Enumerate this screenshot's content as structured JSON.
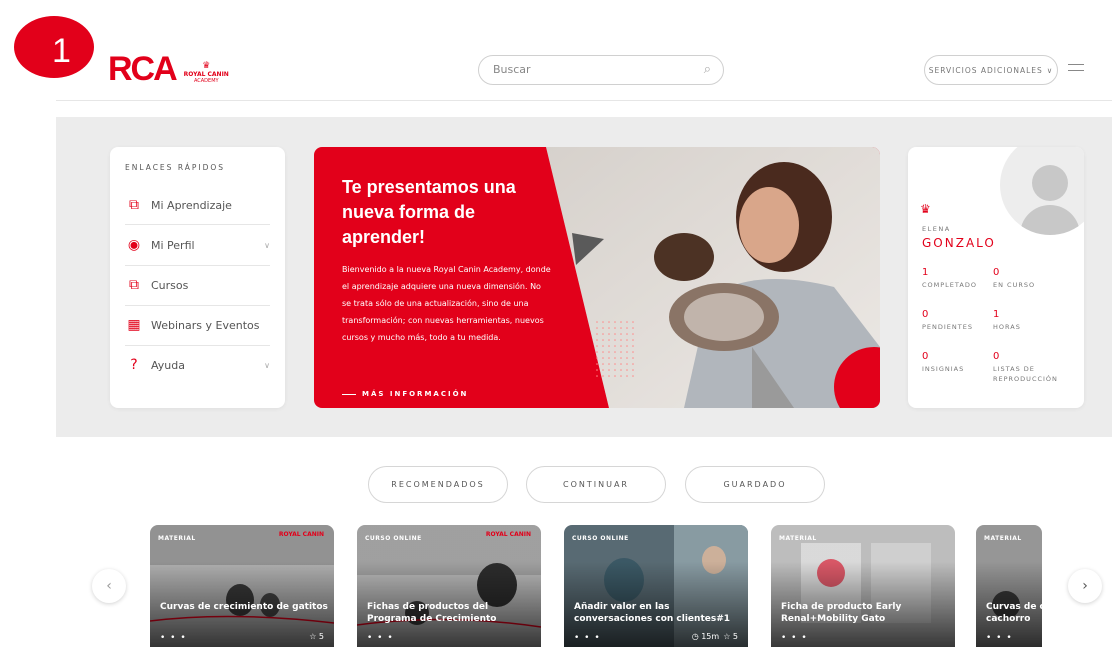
{
  "annotation": {
    "step_number": "1"
  },
  "header": {
    "logo_text": "RCA",
    "logo_brand": "ROYAL CANIN",
    "logo_sub": "ACADEMY",
    "search_placeholder": "Buscar",
    "services_label": "SERVICIOS ADICIONALES",
    "services_chevron": "∨",
    "menu_icon": "hamburger-icon"
  },
  "quick_links": {
    "title": "ENLACES RÁPIDOS",
    "items": [
      {
        "label": "Mi Aprendizaje",
        "icon": "book-icon",
        "glyph": "⧉",
        "has_chevron": false
      },
      {
        "label": "Mi Perfil",
        "icon": "user-circle-icon",
        "glyph": "◉",
        "has_chevron": true
      },
      {
        "label": "Cursos",
        "icon": "open-book-icon",
        "glyph": "⧉",
        "has_chevron": false
      },
      {
        "label": "Webinars y Eventos",
        "icon": "calendar-icon",
        "glyph": "▦",
        "has_chevron": false
      },
      {
        "label": "Ayuda",
        "icon": "help-icon",
        "glyph": "?",
        "has_chevron": true
      }
    ],
    "chevron": "∨"
  },
  "banner": {
    "title": "Te presentamos una nueva forma de aprender!",
    "body": "Bienvenido a la nueva Royal Canin Academy, donde el aprendizaje adquiere una nueva dimensión. No se trata sólo de una actualización, sino de una transformación; con nuevas herramientas, nuevos cursos y mucho más, todo a tu medida.",
    "link_label": "MÁS INFORMACIÓN",
    "accent": "#e2001a"
  },
  "profile": {
    "first_name": "ELENA",
    "last_name": "GONZALO",
    "stats": [
      {
        "value": "1",
        "label": "COMPLETADO"
      },
      {
        "value": "0",
        "label": "EN CURSO"
      },
      {
        "value": "0",
        "label": "PENDIENTES"
      },
      {
        "value": "1",
        "label": "HORAS"
      },
      {
        "value": "0",
        "label": "INSIGNIAS"
      },
      {
        "value": "0",
        "label": "LISTAS DE REPRODUCCIÓN"
      }
    ]
  },
  "tabs": [
    {
      "label": "RECOMENDADOS"
    },
    {
      "label": "CONTINUAR"
    },
    {
      "label": "GUARDADO"
    }
  ],
  "carousel": {
    "prev_glyph": "‹",
    "next_glyph": "›",
    "cards": [
      {
        "category": "MATERIAL",
        "title": "Curvas de crecimiento de gatitos",
        "dots": "• • •",
        "rating": "☆ 5",
        "duration": "",
        "brand": "ROYAL CANIN"
      },
      {
        "category": "CURSO ONLINE",
        "title": "Fichas de productos del Programa de Crecimiento",
        "dots": "• • •",
        "rating": "",
        "duration": "",
        "brand": "ROYAL CANIN"
      },
      {
        "category": "CURSO ONLINE",
        "title": "Añadir valor en las conversaciones con clientes#1",
        "dots": "• • •",
        "rating": "☆ 5",
        "duration": "◷ 15m",
        "brand": ""
      },
      {
        "category": "MATERIAL",
        "title": "Ficha de producto Early Renal+Mobility Gato",
        "dots": "• • •",
        "rating": "",
        "duration": "",
        "brand": ""
      },
      {
        "category": "MATERIAL",
        "title": "Curvas de c cachorro",
        "dots": "• • •",
        "rating": "",
        "duration": "",
        "brand": ""
      }
    ]
  }
}
